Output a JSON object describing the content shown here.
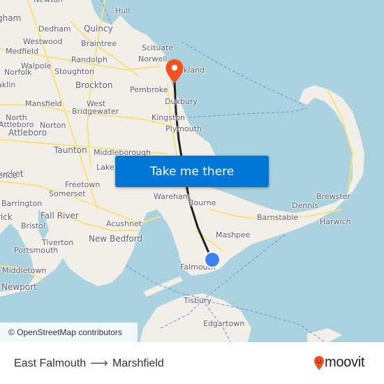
{
  "map": {
    "attribution": "© OpenStreetMap contributors",
    "colors": {
      "water": "#aad3df",
      "land": "#f2efe9",
      "road": "#f7e27e",
      "route_line": "#222222",
      "origin_dot": "#3b82f6",
      "destination_pin": "#f4511e"
    },
    "places": [
      {
        "name": "Newton",
        "size": "s"
      },
      {
        "name": "Hull",
        "size": "s"
      },
      {
        "name": "gham",
        "size": "m"
      },
      {
        "name": "Dedham",
        "size": "s"
      },
      {
        "name": "Quincy",
        "size": "m"
      },
      {
        "name": "Westwood",
        "size": "s"
      },
      {
        "name": "Braintree",
        "size": "s"
      },
      {
        "name": "Scituate",
        "size": "s"
      },
      {
        "name": "Medfield",
        "size": "s"
      },
      {
        "name": "Norwell",
        "size": "s"
      },
      {
        "name": "Randolph",
        "size": "s"
      },
      {
        "name": "Walpole",
        "size": "s"
      },
      {
        "name": "Rockland",
        "size": "s"
      },
      {
        "name": "Norfolk",
        "size": "s"
      },
      {
        "name": "Stoughton",
        "size": "s"
      },
      {
        "name": "aklin",
        "size": "s"
      },
      {
        "name": "Brockton",
        "size": "m"
      },
      {
        "name": "Pembroke",
        "size": "s"
      },
      {
        "name": "Duxbury",
        "size": "s"
      },
      {
        "name": "Mansfield",
        "size": "s"
      },
      {
        "name": "West",
        "size": "s"
      },
      {
        "name": "Bridgewater",
        "size": "s"
      },
      {
        "name": "North",
        "size": "s"
      },
      {
        "name": "Attleboro",
        "size": "s"
      },
      {
        "name": "Kingston",
        "size": "s"
      },
      {
        "name": "Norton",
        "size": "s"
      },
      {
        "name": "Attleboro",
        "size": "m"
      },
      {
        "name": "Plymouth",
        "size": "s"
      },
      {
        "name": "Taunton",
        "size": "m"
      },
      {
        "name": "Middleborough",
        "size": "s"
      },
      {
        "name": "tucket",
        "size": "m"
      },
      {
        "name": "Lake",
        "size": "s"
      },
      {
        "name": "ence",
        "size": "m"
      },
      {
        "name": "Freetown",
        "size": "s"
      },
      {
        "name": "Somerset",
        "size": "s"
      },
      {
        "name": "Wareham",
        "size": "s"
      },
      {
        "name": "Bourne",
        "size": "s"
      },
      {
        "name": "Dennis",
        "size": "s"
      },
      {
        "name": "Brewster",
        "size": "s"
      },
      {
        "name": "Barrington",
        "size": "s"
      },
      {
        "name": "Fall River",
        "size": "m"
      },
      {
        "name": "Barnstable",
        "size": "s"
      },
      {
        "name": "Harwich",
        "size": "s"
      },
      {
        "name": "rick",
        "size": "m"
      },
      {
        "name": "Bristol",
        "size": "s"
      },
      {
        "name": "Acushnet",
        "size": "s"
      },
      {
        "name": "Mashpee",
        "size": "s"
      },
      {
        "name": "Tiverton",
        "size": "s"
      },
      {
        "name": "New Bedford",
        "size": "m"
      },
      {
        "name": "Portsmouth",
        "size": "s"
      },
      {
        "name": "Falmouth",
        "size": "s"
      },
      {
        "name": "Middletown",
        "size": "s"
      },
      {
        "name": "Newport",
        "size": "m"
      },
      {
        "name": "Tisbury",
        "size": "s"
      },
      {
        "name": "Edgartown",
        "size": "s"
      }
    ]
  },
  "cta": {
    "label": "Take me there"
  },
  "footer": {
    "origin": "East Falmouth",
    "arrow": "⟶",
    "destination": "Marshfield",
    "brand": "moovit"
  }
}
